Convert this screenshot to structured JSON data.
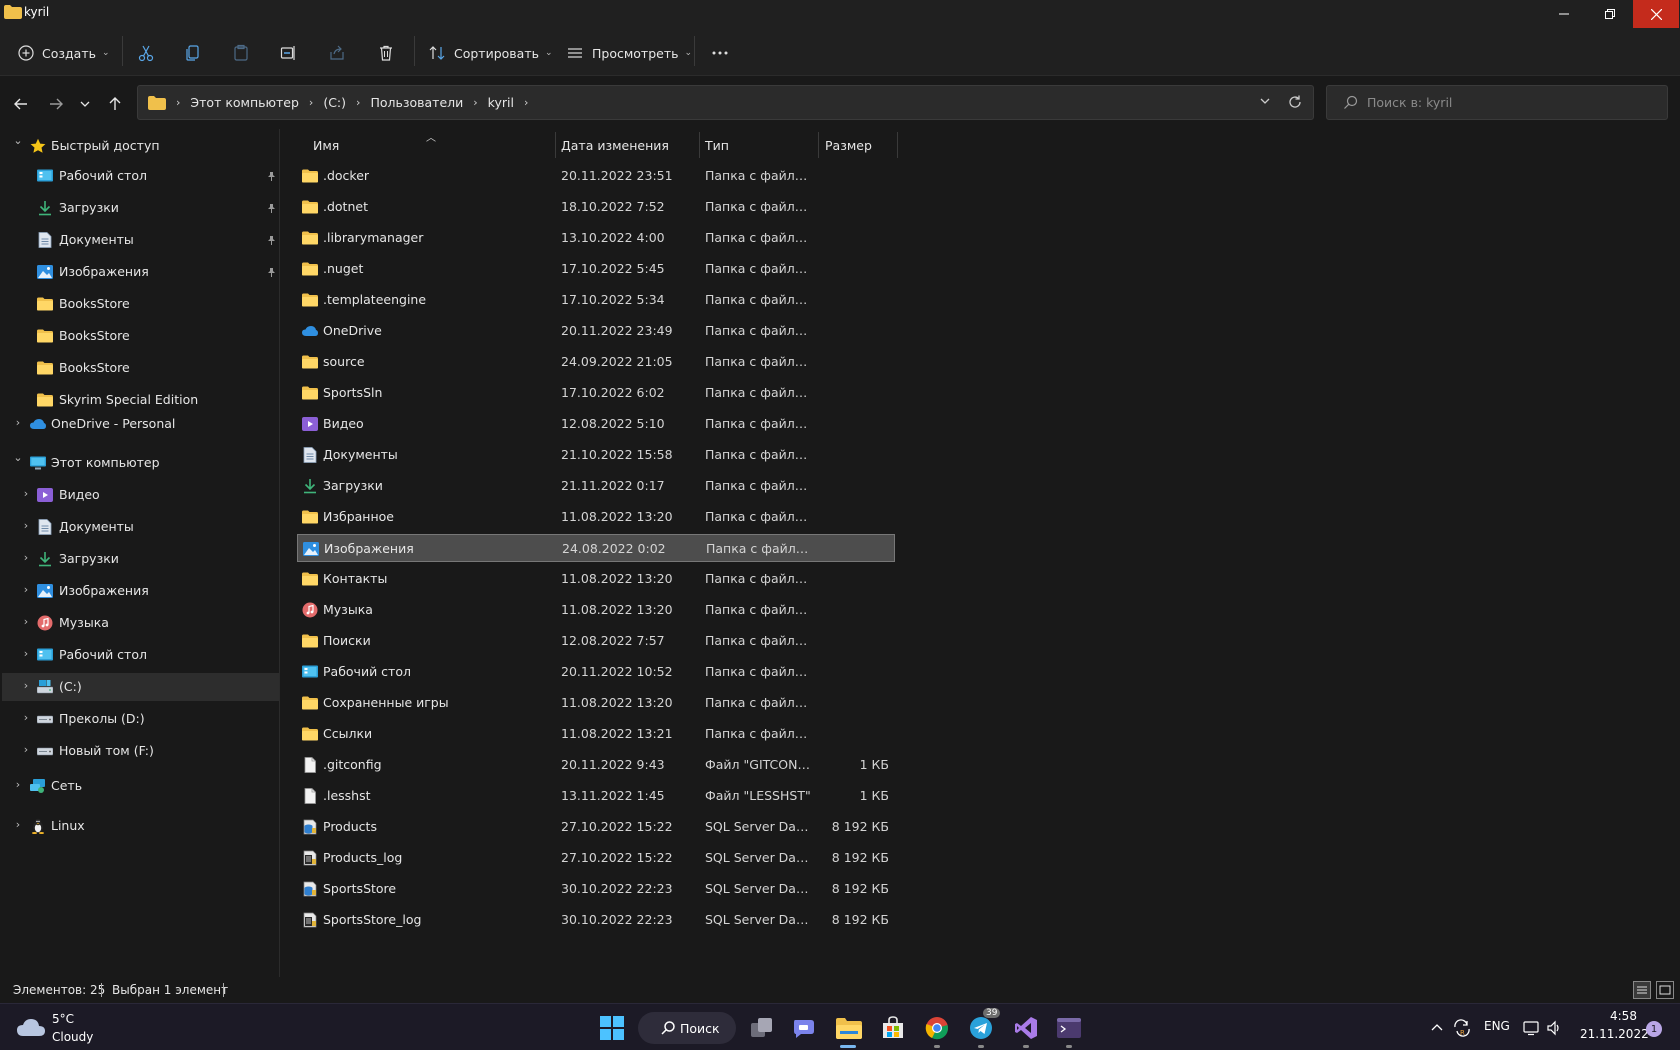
{
  "window": {
    "title": "kyril",
    "close_color": "#c42b1c"
  },
  "toolbar": {
    "create_label": "Создать",
    "sort_label": "Сортировать",
    "view_label": "Просмотреть"
  },
  "address": {
    "crumbs": [
      "Этот компьютер",
      "(C:)",
      "Пользователи",
      "kyril"
    ],
    "search_placeholder": "Поиск в: kyril"
  },
  "sidebar": {
    "quick_access": "Быстрый доступ",
    "quick_items": [
      "Рабочий стол",
      "Загрузки",
      "Документы",
      "Изображения",
      "BooksStore",
      "BooksStore",
      "BooksStore",
      "Skyrim Special Edition"
    ],
    "onedrive": "OneDrive - Personal",
    "this_pc": "Этот компьютер",
    "pc_items": [
      "Видео",
      "Документы",
      "Загрузки",
      "Изображения",
      "Музыка",
      "Рабочий стол",
      "(C:)",
      "Преколы (D:)",
      "Новый том (F:)"
    ],
    "network": "Сеть",
    "linux": "Linux",
    "selected": "(C:)"
  },
  "columns": {
    "name": "Имя",
    "date": "Дата изменения",
    "type": "Тип",
    "size": "Размер"
  },
  "files": [
    {
      "name": ".docker",
      "date": "20.11.2022 23:51",
      "type": "Папка с файлами",
      "size": "",
      "icon": "folder"
    },
    {
      "name": ".dotnet",
      "date": "18.10.2022 7:52",
      "type": "Папка с файлами",
      "size": "",
      "icon": "folder"
    },
    {
      "name": ".librarymanager",
      "date": "13.10.2022 4:00",
      "type": "Папка с файлами",
      "size": "",
      "icon": "folder"
    },
    {
      "name": ".nuget",
      "date": "17.10.2022 5:45",
      "type": "Папка с файлами",
      "size": "",
      "icon": "folder"
    },
    {
      "name": ".templateengine",
      "date": "17.10.2022 5:34",
      "type": "Папка с файлами",
      "size": "",
      "icon": "folder"
    },
    {
      "name": "OneDrive",
      "date": "20.11.2022 23:49",
      "type": "Папка с файлами",
      "size": "",
      "icon": "cloud"
    },
    {
      "name": "source",
      "date": "24.09.2022 21:05",
      "type": "Папка с файлами",
      "size": "",
      "icon": "folder"
    },
    {
      "name": "SportsSln",
      "date": "17.10.2022 6:02",
      "type": "Папка с файлами",
      "size": "",
      "icon": "folder"
    },
    {
      "name": "Видео",
      "date": "12.08.2022 5:10",
      "type": "Папка с файлами",
      "size": "",
      "icon": "video"
    },
    {
      "name": "Документы",
      "date": "21.10.2022 15:58",
      "type": "Папка с файлами",
      "size": "",
      "icon": "document"
    },
    {
      "name": "Загрузки",
      "date": "21.11.2022 0:17",
      "type": "Папка с файлами",
      "size": "",
      "icon": "download"
    },
    {
      "name": "Избранное",
      "date": "11.08.2022 13:20",
      "type": "Папка с файлами",
      "size": "",
      "icon": "folder"
    },
    {
      "name": "Изображения",
      "date": "24.08.2022 0:02",
      "type": "Папка с файлами",
      "size": "",
      "icon": "picture"
    },
    {
      "name": "Контакты",
      "date": "11.08.2022 13:20",
      "type": "Папка с файлами",
      "size": "",
      "icon": "folder"
    },
    {
      "name": "Музыка",
      "date": "11.08.2022 13:20",
      "type": "Папка с файлами",
      "size": "",
      "icon": "music"
    },
    {
      "name": "Поиски",
      "date": "12.08.2022 7:57",
      "type": "Папка с файлами",
      "size": "",
      "icon": "folder"
    },
    {
      "name": "Рабочий стол",
      "date": "20.11.2022 10:52",
      "type": "Папка с файлами",
      "size": "",
      "icon": "desktop"
    },
    {
      "name": "Сохраненные игры",
      "date": "11.08.2022 13:20",
      "type": "Папка с файлами",
      "size": "",
      "icon": "folder"
    },
    {
      "name": "Ссылки",
      "date": "11.08.2022 13:21",
      "type": "Папка с файлами",
      "size": "",
      "icon": "folder"
    },
    {
      "name": ".gitconfig",
      "date": "20.11.2022 9:43",
      "type": "Файл \"GITCONFIG\"",
      "size": "1 КБ",
      "icon": "file"
    },
    {
      "name": ".lesshst",
      "date": "13.11.2022 1:45",
      "type": "Файл \"LESSHST\"",
      "size": "1 КБ",
      "icon": "file"
    },
    {
      "name": "Products",
      "date": "27.10.2022 15:22",
      "type": "SQL Server Databa...",
      "size": "8 192 КБ",
      "icon": "database"
    },
    {
      "name": "Products_log",
      "date": "27.10.2022 15:22",
      "type": "SQL Server Databa...",
      "size": "8 192 КБ",
      "icon": "database-log"
    },
    {
      "name": "SportsStore",
      "date": "30.10.2022 22:23",
      "type": "SQL Server Databa...",
      "size": "8 192 КБ",
      "icon": "database"
    },
    {
      "name": "SportsStore_log",
      "date": "30.10.2022 22:23",
      "type": "SQL Server Databa...",
      "size": "8 192 КБ",
      "icon": "database-log"
    }
  ],
  "selected_file": "Изображения",
  "status": {
    "count": "Элементов: 25",
    "selection": "Выбран 1 элемент"
  },
  "taskbar": {
    "weather_temp": "5°C",
    "weather_desc": "Cloudy",
    "search_label": "Поиск",
    "telegram_badge": "39",
    "lang": "ENG",
    "time": "4:58",
    "date": "21.11.2022",
    "notification_count": "1"
  }
}
